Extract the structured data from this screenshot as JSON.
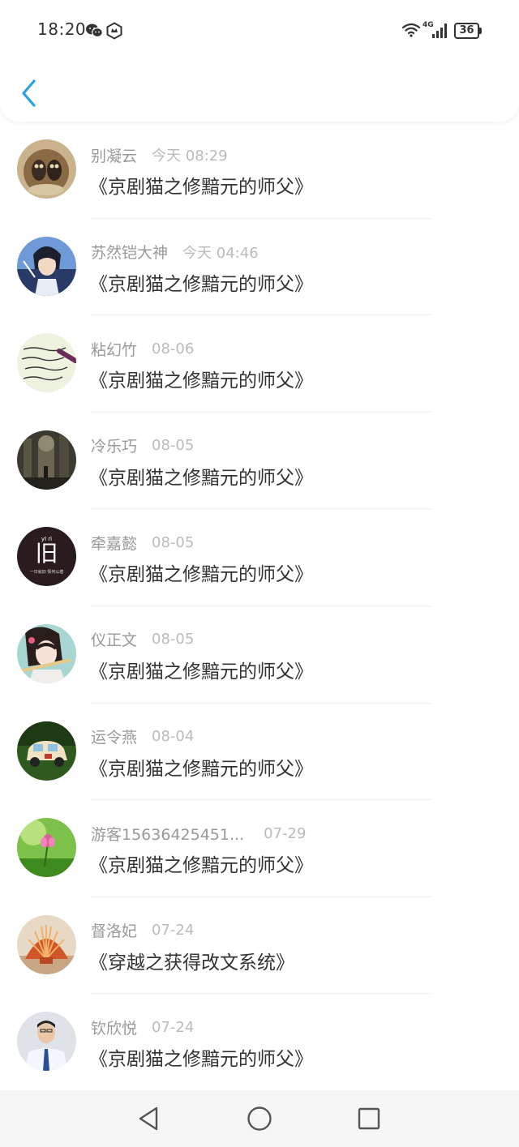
{
  "status_bar": {
    "time": "18:20",
    "network": "4G",
    "battery": "36",
    "icons": [
      "wechat-icon",
      "hexagon-app-icon",
      "wifi-icon",
      "signal-icon",
      "battery-icon"
    ]
  },
  "header": {
    "back_icon": "chevron-left-icon",
    "accent_color": "#2aa0e8"
  },
  "comments": [
    {
      "username": "别凝云",
      "time": "今天 08:29",
      "book": "《京剧猫之修黯元的师父》",
      "avatar": "avatar-owls"
    },
    {
      "username": "苏然铠大神",
      "time": "今天 04:46",
      "book": "《京剧猫之修黯元的师父》",
      "avatar": "avatar-anime-boy"
    },
    {
      "username": "粘幻竹",
      "time": "08-06",
      "book": "《京剧猫之修黯元的师父》",
      "avatar": "avatar-handwriting"
    },
    {
      "username": "冷乐巧",
      "time": "08-05",
      "book": "《京剧猫之修黯元的师父》",
      "avatar": "avatar-dark-scene"
    },
    {
      "username": "牵嘉懿",
      "time": "08-05",
      "book": "《京剧猫之修黯元的师父》",
      "avatar": "avatar-jiu-logo"
    },
    {
      "username": "仪正文",
      "time": "08-05",
      "book": "《京剧猫之修黯元的师父》",
      "avatar": "avatar-girl-flute"
    },
    {
      "username": "运令燕",
      "time": "08-04",
      "book": "《京剧猫之修黯元的师父》",
      "avatar": "avatar-toy-car"
    },
    {
      "username": "游客15636425451...",
      "time": "07-29",
      "book": "《京剧猫之修黯元的师父》",
      "avatar": "avatar-flower"
    },
    {
      "username": "督洛妃",
      "time": "07-24",
      "book": "《穿越之获得改文系统》",
      "avatar": "avatar-shell"
    },
    {
      "username": "钦欣悦",
      "time": "07-24",
      "book": "《京剧猫之修黯元的师父》",
      "avatar": "avatar-businessman"
    }
  ],
  "avatar_misc": {
    "jiu_logo_text": "旧",
    "jiu_logo_pinyin": "yī rì",
    "jiu_logo_caption": "一日就旧 情何以堪"
  },
  "nav_bar": {
    "back_icon": "triangle-back-icon",
    "home_icon": "circle-home-icon",
    "recents_icon": "square-recents-icon"
  }
}
